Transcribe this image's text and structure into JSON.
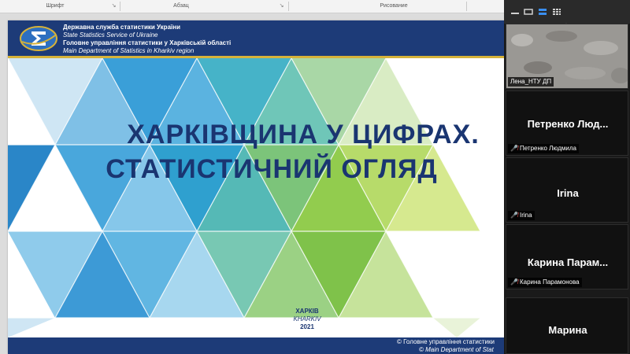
{
  "ribbon": {
    "groups": [
      "Шрифт",
      "Абзац",
      "Рисование"
    ]
  },
  "slide": {
    "header": {
      "line1": "Державна служба статистики України",
      "line2": "State Statistics Service of Ukraine",
      "line3": "Головне управління статистики у Харківській області",
      "line4": "Main Department of Statistics in Kharkiv region"
    },
    "title_line1": "ХАРКІВЩИНА У ЦИФРАХ.",
    "title_line2": "СТАТИСТИЧНИЙ ОГЛЯД",
    "place_ua": "ХАРКІВ",
    "place_en": "KHARKIV",
    "year": "2021",
    "footer_line1": "© Головне управління статистики",
    "footer_line2": "© Main Department of Stat",
    "colors": {
      "navy": "#1d3b78",
      "gold": "#d6b23a",
      "title": "#1a3571"
    }
  },
  "panel": {
    "participants": [
      {
        "display": "",
        "tag": "Лена_НТУ ДП",
        "has_video": true,
        "muted": false
      },
      {
        "display": "Петренко Люд...",
        "tag": "Петренко Людмила",
        "has_video": false,
        "muted": true
      },
      {
        "display": "Irina",
        "tag": "Irina",
        "has_video": false,
        "muted": true
      },
      {
        "display": "Карина Парам...",
        "tag": "Карина Парамонова",
        "has_video": false,
        "muted": true
      },
      {
        "display": "Марина",
        "tag": "",
        "has_video": false,
        "muted": false
      }
    ],
    "icons": [
      "minimize-icon",
      "speaker-view-icon",
      "active-view-icon",
      "gallery-view-icon",
      "scroll-up-icon",
      "muted-mic-icon"
    ]
  }
}
